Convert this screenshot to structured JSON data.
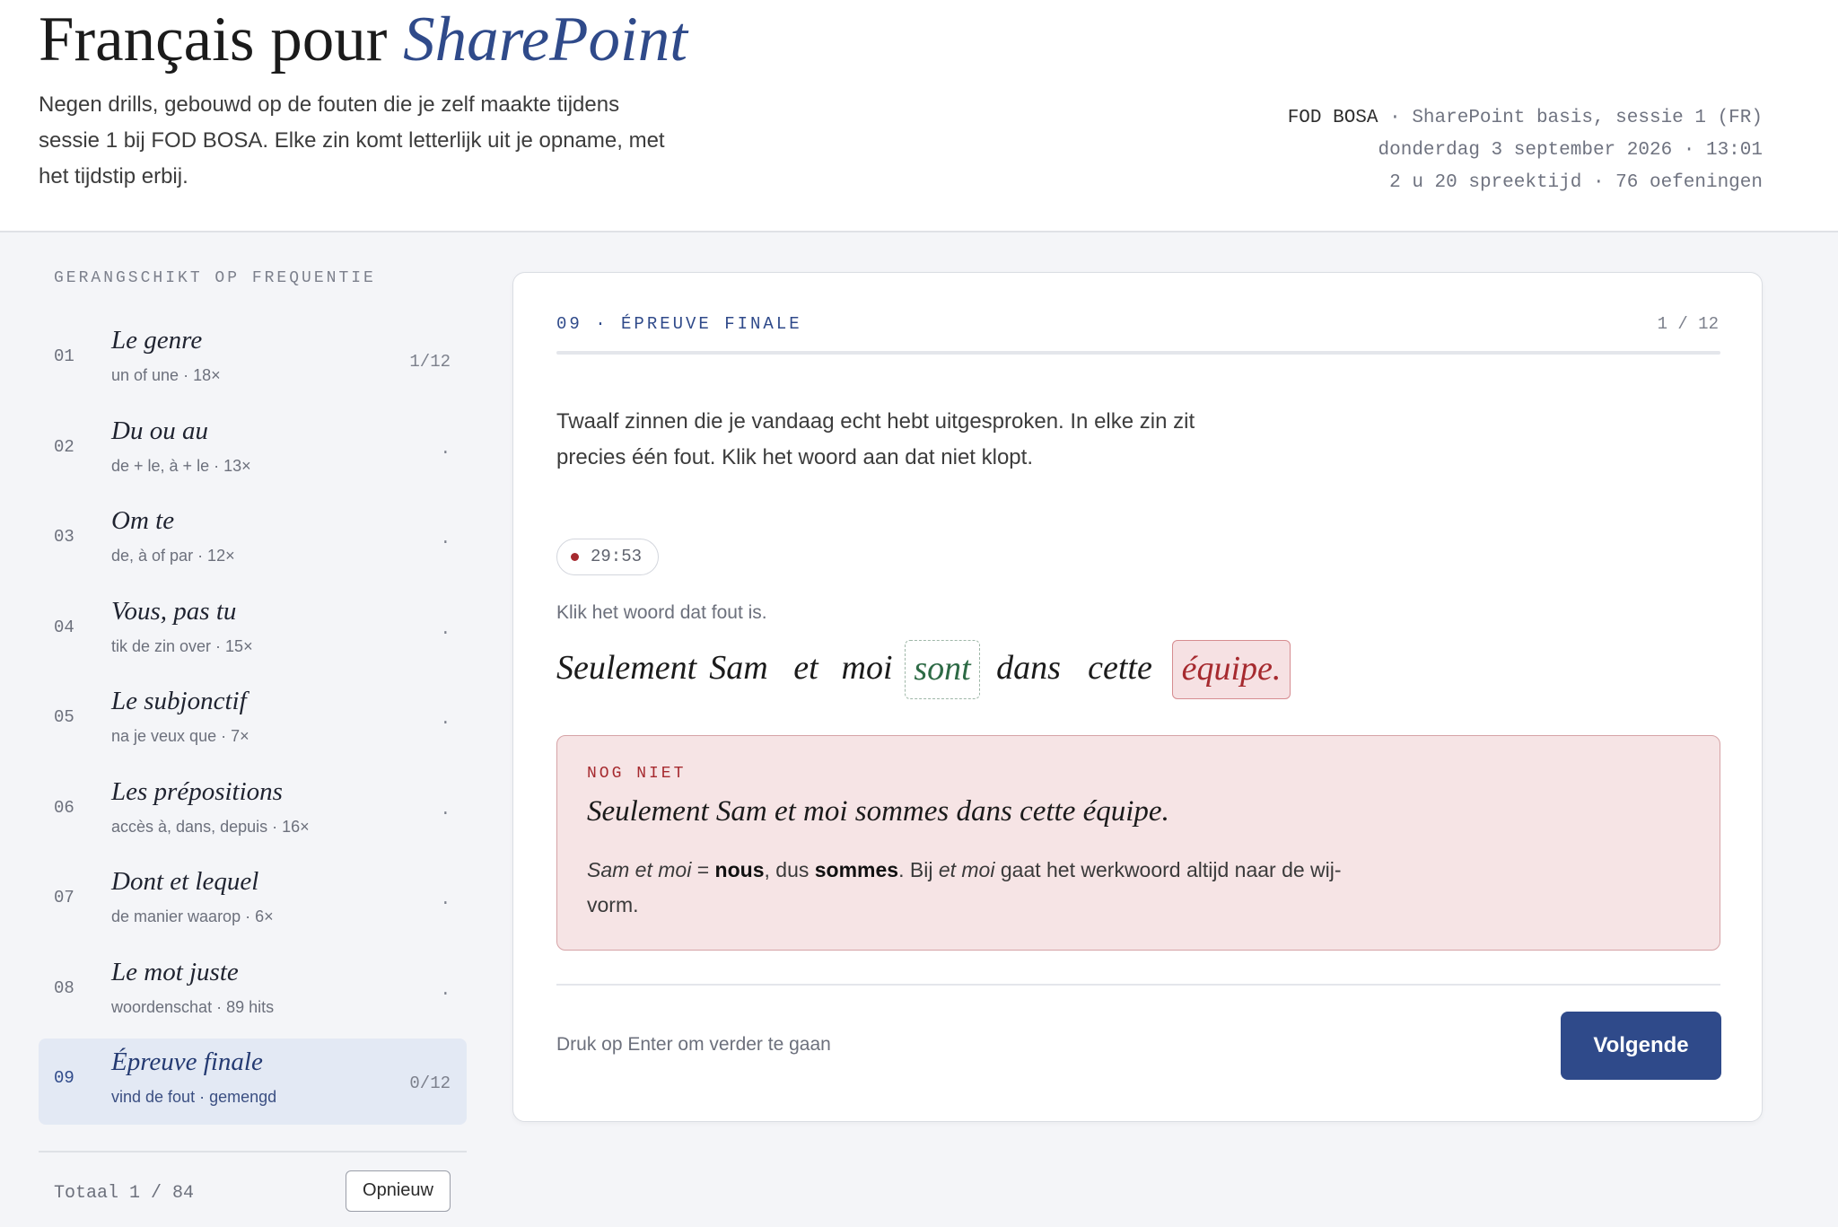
{
  "header": {
    "title_main": "Français pour",
    "title_accent": "SharePoint",
    "subtitle": "Negen drills, gebouwd op de fouten die je zelf maakte tijdens sessie 1 bij FOD BOSA. Elke zin komt letterlijk uit je opname, met het tijdstip erbij.",
    "meta_org": "FOD BOSA",
    "meta_session": " · SharePoint basis, sessie 1 (FR)",
    "meta_date": "donderdag 3 september 2026 · 13:01",
    "meta_stats": "2 u 20 spreektijd · 76 oefeningen"
  },
  "sidebar": {
    "label": "GERANGSCHIKT OP FREQUENTIE",
    "drills": [
      {
        "num": "01",
        "name": "Le genre",
        "sub": "un of une · 18×",
        "progress": "1/12"
      },
      {
        "num": "02",
        "name": "Du ou au",
        "sub": "de + le, à + le · 13×",
        "progress": "·"
      },
      {
        "num": "03",
        "name": "Om te",
        "sub": "de, à of par · 12×",
        "progress": "·"
      },
      {
        "num": "04",
        "name": "Vous, pas tu",
        "sub": "tik de zin over · 15×",
        "progress": "·"
      },
      {
        "num": "05",
        "name": "Le subjonctif",
        "sub": "na je veux que · 7×",
        "progress": "·"
      },
      {
        "num": "06",
        "name": "Les prépositions",
        "sub": "accès à, dans, depuis · 16×",
        "progress": "·"
      },
      {
        "num": "07",
        "name": "Dont et lequel",
        "sub": "de manier waarop · 6×",
        "progress": "·"
      },
      {
        "num": "08",
        "name": "Le mot juste",
        "sub": "woordenschat · 89 hits",
        "progress": "·"
      },
      {
        "num": "09",
        "name": "Épreuve finale",
        "sub": "vind de fout · gemengd",
        "progress": "0/12"
      }
    ],
    "total": "Totaal 1 / 84",
    "reset_label": "Opnieuw"
  },
  "exercise": {
    "heading": "09 · ÉPREUVE FINALE",
    "count": "1 / 12",
    "progress_fraction": 0.0,
    "intro": "Twaalf zinnen die je vandaag echt hebt uitgesproken. In elke zin zit precies één fout. Klik het woord aan dat niet klopt.",
    "timestamp": "29:53",
    "instruction": "Klik het woord dat fout is.",
    "words": [
      "Seulement",
      "Sam",
      "et",
      "moi",
      "sont",
      "dans",
      "cette",
      "équipe."
    ],
    "feedback": {
      "label": "NOG NIET",
      "sentence": "Seulement Sam et moi sommes dans cette équipe.",
      "expl_1": "Sam et moi",
      "expl_2": " = ",
      "expl_3": "nous",
      "expl_4": ", dus ",
      "expl_5": "sommes",
      "expl_6": ". Bij ",
      "expl_7": "et moi",
      "expl_8": " gaat het werkwoord altijd naar de wij-vorm."
    },
    "hint": "Druk op Enter om verder te gaan",
    "next_label": "Volgende"
  },
  "colors": {
    "accent": "#2f4a8a",
    "error": "#a62a2f",
    "error_bg": "#f6e4e5",
    "correct": "#2d6a45"
  }
}
